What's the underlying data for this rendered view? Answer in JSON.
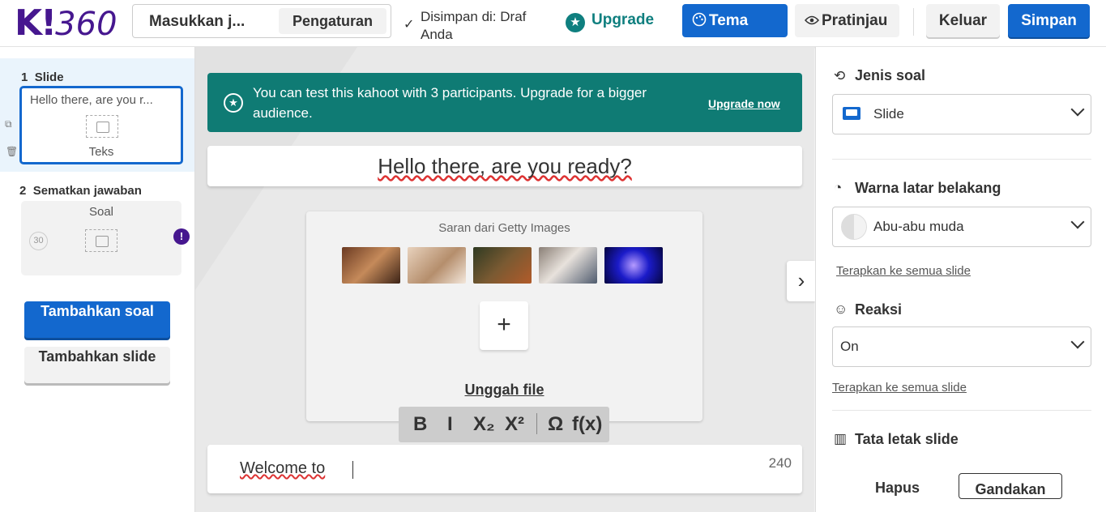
{
  "header": {
    "logo": "K!",
    "logo_num": "360",
    "title_placeholder": "Masukkan j...",
    "settings_label": "Pengaturan",
    "saved_status": "Disimpan di: Draf Anda",
    "upgrade_label": "Upgrade",
    "tema_label": "Tema",
    "pratinjau_label": "Pratinjau",
    "keluar_label": "Keluar",
    "simpan_label": "Simpan"
  },
  "sidebar": {
    "slides": [
      {
        "number": "1",
        "type": "Slide",
        "title": "Hello there, are you r...",
        "caption": "Teks"
      },
      {
        "number": "2",
        "type": "Sematkan jawaban",
        "caption": "Soal",
        "timer": "30"
      }
    ],
    "add_question": "Tambahkan soal",
    "add_slide": "Tambahkan slide"
  },
  "canvas": {
    "banner_message": "You can test this kahoot with 3 participants. Upgrade for a bigger audience.",
    "banner_link": "Upgrade now",
    "question": "Hello there, are you ready?",
    "media_hint": "Saran dari Getty Images",
    "upload_label": "Unggah file",
    "toolbar": {
      "bold": "B",
      "italic": "I",
      "subscript": "X₂",
      "superscript": "X²",
      "omega": "Ω",
      "fx": "f(x)"
    },
    "answer_text": "Welcome to",
    "char_count": "240"
  },
  "rpanel": {
    "question_type_title": "Jenis soal",
    "question_type_value": "Slide",
    "bg_color_title": "Warna latar belakang",
    "bg_color_value": "Abu-abu muda",
    "apply_all_1": "Terapkan ke semua slide",
    "reaction_title": "Reaksi",
    "reaction_value": "On",
    "apply_all_2": "Terapkan ke semua slide",
    "layout_title": "Tata letak slide",
    "delete_label": "Hapus",
    "duplicate_label": "Gandakan"
  },
  "colors": {
    "brand": "#46178f",
    "primary": "#1368ce",
    "teal": "#0f7b74"
  }
}
